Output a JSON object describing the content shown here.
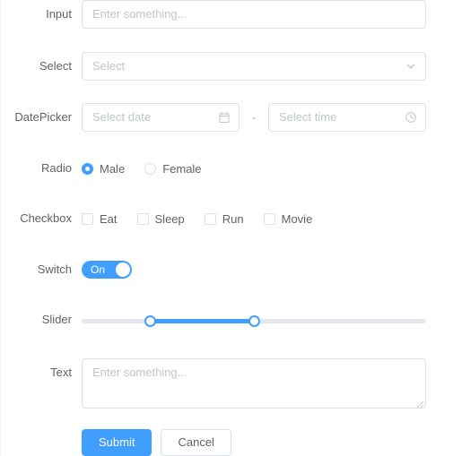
{
  "form": {
    "rows": [
      {
        "label": "Input",
        "type": "input",
        "placeholder": "Enter something...",
        "value": ""
      },
      {
        "label": "Select",
        "type": "select",
        "placeholder": "Select",
        "value": "",
        "icon": "chevron-down-icon"
      },
      {
        "label": "DatePicker",
        "type": "daterange",
        "date_placeholder": "Select date",
        "date_value": "",
        "date_icon": "calendar-icon",
        "separator": "-",
        "time_placeholder": "Select time",
        "time_value": "",
        "time_icon": "clock-icon"
      },
      {
        "label": "Radio",
        "type": "radio",
        "options": [
          {
            "label": "Male",
            "checked": true
          },
          {
            "label": "Female",
            "checked": false
          }
        ]
      },
      {
        "label": "Checkbox",
        "type": "checkbox",
        "options": [
          {
            "label": "Eat",
            "checked": false
          },
          {
            "label": "Sleep",
            "checked": false
          },
          {
            "label": "Run",
            "checked": false
          },
          {
            "label": "Movie",
            "checked": false
          }
        ]
      },
      {
        "label": "Switch",
        "type": "switch",
        "state_label": "On",
        "on": true
      },
      {
        "label": "Slider",
        "type": "slider",
        "range_start_percent": 20,
        "range_end_percent": 50
      },
      {
        "label": "Text",
        "type": "textarea",
        "placeholder": "Enter something...",
        "value": ""
      }
    ],
    "actions": {
      "submit_label": "Submit",
      "cancel_label": "Cancel"
    }
  },
  "colors": {
    "primary": "#409eff",
    "border": "#dcdfe6",
    "label_text": "#606266",
    "placeholder_text": "#c0c4cc",
    "track": "#e4e7ed"
  }
}
